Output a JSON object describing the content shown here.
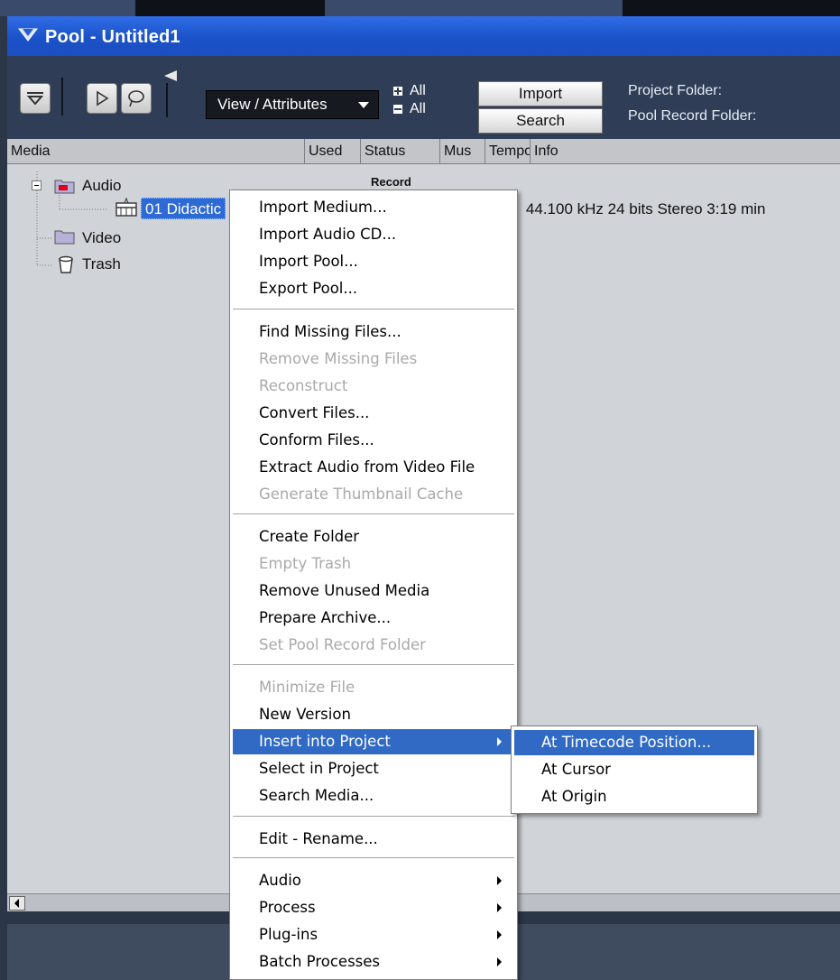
{
  "window": {
    "title": "Pool - Untitled1"
  },
  "toolbar": {
    "view_label": "View / Attributes",
    "expand_all": "All",
    "collapse_all": "All",
    "import_label": "Import",
    "search_label": "Search",
    "project_folder_label": "Project Folder:",
    "pool_record_folder_label": "Pool Record Folder:"
  },
  "columns": [
    "Media",
    "Used",
    "Status",
    "Mus",
    "Tempo",
    "Info"
  ],
  "tree": {
    "audio": "Audio",
    "selected_file": "01 Didactic",
    "video": "Video",
    "trash": "Trash",
    "record_status": "Record",
    "tempo": "??",
    "info": "44.100 kHz  24 bits  Stereo  3:19 min"
  },
  "context_menu": {
    "items": [
      {
        "label": "Import Medium...",
        "disabled": false
      },
      {
        "label": "Import Audio CD...",
        "disabled": false
      },
      {
        "label": "Import Pool...",
        "disabled": false
      },
      {
        "label": "Export Pool...",
        "disabled": false
      },
      {
        "label": "Find Missing Files...",
        "disabled": false
      },
      {
        "label": "Remove Missing Files",
        "disabled": true
      },
      {
        "label": "Reconstruct",
        "disabled": true
      },
      {
        "label": "Convert Files...",
        "disabled": false
      },
      {
        "label": "Conform Files...",
        "disabled": false
      },
      {
        "label": "Extract Audio from Video File",
        "disabled": false
      },
      {
        "label": "Generate Thumbnail Cache",
        "disabled": true
      },
      {
        "label": "Create Folder",
        "disabled": false
      },
      {
        "label": "Empty Trash",
        "disabled": true
      },
      {
        "label": "Remove Unused Media",
        "disabled": false
      },
      {
        "label": "Prepare Archive...",
        "disabled": false
      },
      {
        "label": "Set Pool Record Folder",
        "disabled": true
      },
      {
        "label": "Minimize File",
        "disabled": true
      },
      {
        "label": "New Version",
        "disabled": false
      },
      {
        "label": "Insert into Project",
        "disabled": false,
        "submenu": true,
        "active": true
      },
      {
        "label": "Select in Project",
        "disabled": false
      },
      {
        "label": "Search Media...",
        "disabled": false
      },
      {
        "label": "Edit - Rename...",
        "disabled": false
      },
      {
        "label": "Audio",
        "disabled": false,
        "submenu": true
      },
      {
        "label": "Process",
        "disabled": false,
        "submenu": true
      },
      {
        "label": "Plug-ins",
        "disabled": false,
        "submenu": true
      },
      {
        "label": "Batch Processes",
        "disabled": false,
        "submenu": true
      }
    ]
  },
  "submenu": {
    "items": [
      {
        "label": "At Timecode Position...",
        "active": true
      },
      {
        "label": "At Cursor",
        "active": false
      },
      {
        "label": "At Origin",
        "active": false
      }
    ]
  },
  "colors": {
    "title_blue": "#1b52c8",
    "menu_highlight": "#316ac5",
    "selection_blue": "#2e6ad6",
    "list_bg": "#d0d3d7"
  }
}
